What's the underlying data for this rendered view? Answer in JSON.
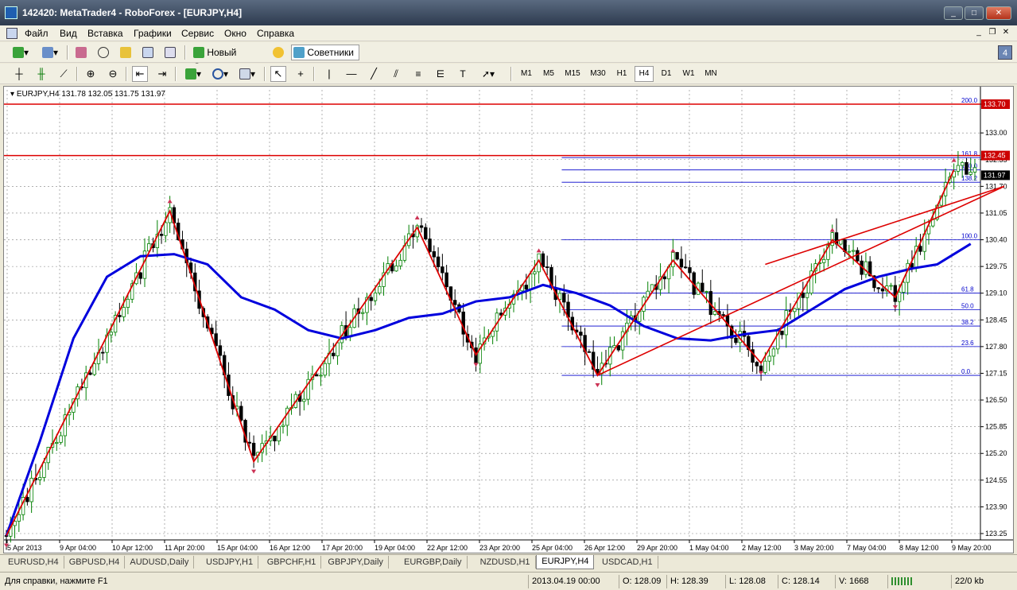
{
  "window": {
    "title": "142420: MetaTrader4 - RoboForex - [EURJPY,H4]"
  },
  "menu": [
    "Файл",
    "Вид",
    "Вставка",
    "Графики",
    "Сервис",
    "Окно",
    "Справка"
  ],
  "toolbar": {
    "new_order": "Новый Ордер",
    "experts": "Советники",
    "notify_badge": "4"
  },
  "timeframes": [
    "M1",
    "M5",
    "M15",
    "M30",
    "H1",
    "H4",
    "D1",
    "W1",
    "MN"
  ],
  "active_timeframe": "H4",
  "chart_header": "EURJPY,H4  131.78 132.05 131.75 131.97",
  "chart_data": {
    "type": "candlestick",
    "symbol": "EURJPY",
    "timeframe": "H4",
    "ohlc_current": {
      "open": 131.78,
      "high": 132.05,
      "low": 131.75,
      "close": 131.97
    },
    "y_ticks": [
      "133.70",
      "133.00",
      "132.35",
      "131.70",
      "131.05",
      "130.40",
      "129.75",
      "129.10",
      "128.45",
      "127.80",
      "127.15",
      "126.50",
      "125.85",
      "125.20",
      "124.55",
      "123.90",
      "123.25"
    ],
    "x_ticks": [
      "5 Apr 2013",
      "9 Apr 04:00",
      "10 Apr 12:00",
      "11 Apr 20:00",
      "15 Apr 04:00",
      "16 Apr 12:00",
      "17 Apr 20:00",
      "19 Apr 04:00",
      "22 Apr 12:00",
      "23 Apr 20:00",
      "25 Apr 04:00",
      "26 Apr 12:00",
      "29 Apr 20:00",
      "1 May 04:00",
      "2 May 12:00",
      "3 May 20:00",
      "7 May 04:00",
      "8 May 12:00",
      "9 May 20:00"
    ],
    "price_labels": [
      {
        "value": "133.70",
        "color": "#cc0000"
      },
      {
        "value": "132.45",
        "color": "#cc0000"
      },
      {
        "value": "131.97",
        "color": "#000000"
      }
    ],
    "horizontal_lines": [
      {
        "price": 133.7,
        "color": "#dd0000",
        "label": "200.0"
      },
      {
        "price": 132.45,
        "color": "#dd0000",
        "label": ""
      }
    ],
    "fib_levels": [
      {
        "label": "161.8",
        "price": 132.4
      },
      {
        "label": "150.0",
        "price": 132.1
      },
      {
        "label": "138.2",
        "price": 131.8
      },
      {
        "label": "100.0",
        "price": 130.4
      },
      {
        "label": "61.8",
        "price": 129.1
      },
      {
        "label": "50.0",
        "price": 128.7
      },
      {
        "label": "38.2",
        "price": 128.3
      },
      {
        "label": "23.6",
        "price": 127.8
      },
      {
        "label": "0.0",
        "price": 127.1
      }
    ],
    "zigzag": [
      [
        0,
        123.2
      ],
      [
        39,
        131.1
      ],
      [
        59,
        125.0
      ],
      [
        98,
        130.7
      ],
      [
        112,
        127.6
      ],
      [
        127,
        129.9
      ],
      [
        141,
        127.1
      ],
      [
        159,
        129.9
      ],
      [
        180,
        127.4
      ],
      [
        197,
        130.4
      ],
      [
        212,
        129.0
      ],
      [
        226,
        132.1
      ]
    ],
    "wedge_upper": [
      [
        181,
        129.8
      ],
      [
        238,
        131.7
      ]
    ],
    "trend_line_upper": [
      [
        141,
        127.1
      ],
      [
        238,
        131.7
      ]
    ],
    "moving_average": [
      [
        0,
        123.2
      ],
      [
        8,
        125.5
      ],
      [
        16,
        128.0
      ],
      [
        24,
        129.5
      ],
      [
        32,
        130.0
      ],
      [
        40,
        130.05
      ],
      [
        48,
        129.8
      ],
      [
        56,
        129.0
      ],
      [
        64,
        128.7
      ],
      [
        72,
        128.2
      ],
      [
        80,
        128.0
      ],
      [
        88,
        128.2
      ],
      [
        96,
        128.5
      ],
      [
        104,
        128.6
      ],
      [
        112,
        128.9
      ],
      [
        120,
        129.0
      ],
      [
        128,
        129.3
      ],
      [
        136,
        129.1
      ],
      [
        144,
        128.8
      ],
      [
        152,
        128.3
      ],
      [
        160,
        128.0
      ],
      [
        168,
        127.95
      ],
      [
        176,
        128.1
      ],
      [
        184,
        128.2
      ],
      [
        192,
        128.7
      ],
      [
        200,
        129.2
      ],
      [
        208,
        129.5
      ],
      [
        216,
        129.7
      ],
      [
        222,
        129.8
      ],
      [
        230,
        130.3
      ]
    ],
    "candles_seed": 2013,
    "bars_total": 232
  },
  "tabs": [
    "EURUSD,H4",
    "GBPUSD,H4",
    "AUDUSD,Daily",
    "USDJPY,H1",
    "GBPCHF,H1",
    "GBPJPY,Daily",
    "EURGBP,Daily",
    "NZDUSD,H1",
    "EURJPY,H4",
    "USDCAD,H1"
  ],
  "active_tab": "EURJPY,H4",
  "status": {
    "help": "Для справки, нажмите F1",
    "time": "2013.04.19 00:00",
    "open": "O: 128.09",
    "high": "H: 128.39",
    "low": "L: 128.08",
    "close": "C: 128.14",
    "volume": "V: 1668",
    "traffic": "22/0 kb"
  },
  "colors": {
    "bull": "#008000",
    "bear": "#000000",
    "ma": "#0000dd",
    "zigzag": "#dd0000",
    "fib": "#0000cc",
    "grid": "#808080"
  }
}
